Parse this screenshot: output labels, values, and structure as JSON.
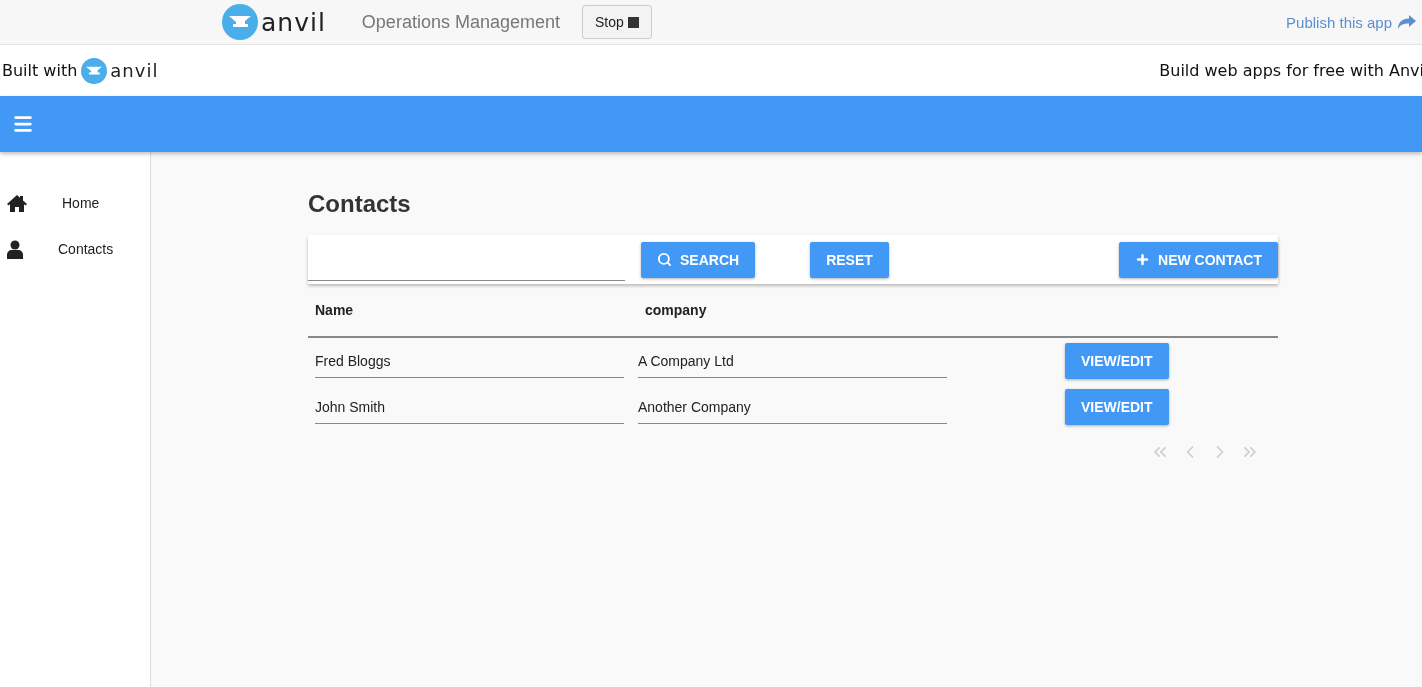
{
  "top_bar": {
    "logo_text": "anvil",
    "app_name": "Operations Management",
    "stop_button": "Stop",
    "publish_link": "Publish this app"
  },
  "banner": {
    "built_with": "Built with",
    "logo_text": "anvil",
    "tagline": "Build web apps for free with Anvi"
  },
  "sidebar": {
    "items": [
      {
        "label": "Home",
        "kind": "home"
      },
      {
        "label": "Contacts",
        "kind": "person"
      }
    ]
  },
  "page": {
    "title": "Contacts",
    "search": {
      "button": "SEARCH"
    },
    "reset_button": "RESET",
    "new_button": "NEW CONTACT"
  },
  "table": {
    "columns": [
      "Name",
      "company"
    ],
    "rows": [
      {
        "name": "Fred Bloggs",
        "company": "A Company Ltd",
        "action": "VIEW/EDIT"
      },
      {
        "name": "John Smith",
        "company": "Another Company",
        "action": "VIEW/EDIT"
      }
    ]
  },
  "pager": [
    {
      "kind": "first",
      "disabled": true
    },
    {
      "kind": "prev",
      "disabled": true
    },
    {
      "kind": "next",
      "disabled": true
    },
    {
      "kind": "last",
      "disabled": true
    }
  ]
}
